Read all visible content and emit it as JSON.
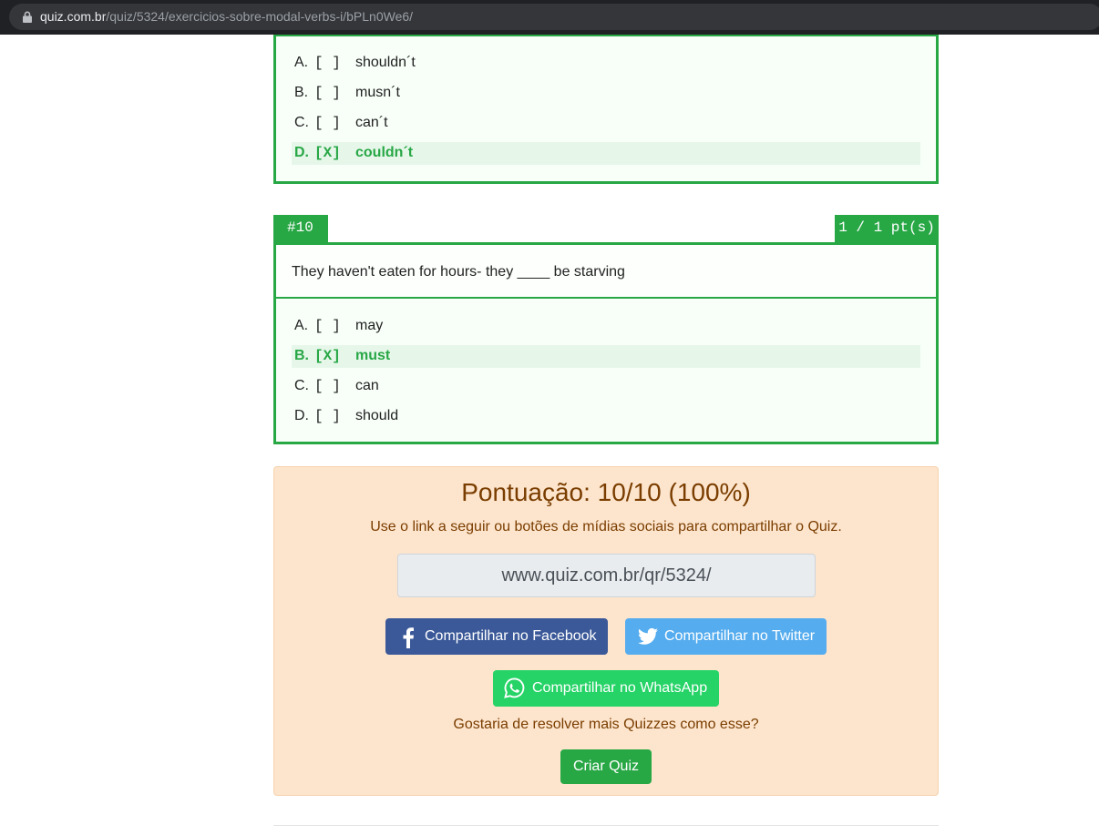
{
  "browser": {
    "url_host": "quiz.com.br",
    "url_path": "/quiz/5324/exercicios-sobre-modal-verbs-i/bPLn0We6/"
  },
  "question_prev": {
    "options": [
      {
        "letter": "A.",
        "mark": "[ ]",
        "text": "shouldn´t",
        "selected": false
      },
      {
        "letter": "B.",
        "mark": "[ ]",
        "text": "musn´t",
        "selected": false
      },
      {
        "letter": "C.",
        "mark": "[ ]",
        "text": "can´t",
        "selected": false
      },
      {
        "letter": "D.",
        "mark": "[X]",
        "text": "couldn´t",
        "selected": true
      }
    ]
  },
  "question_10": {
    "number": "#10",
    "points": "1 / 1 pt(s)",
    "stem": "They haven't eaten for hours- they ____ be starving",
    "options": [
      {
        "letter": "A.",
        "mark": "[ ]",
        "text": "may",
        "selected": false
      },
      {
        "letter": "B.",
        "mark": "[X]",
        "text": "must",
        "selected": true
      },
      {
        "letter": "C.",
        "mark": "[ ]",
        "text": "can",
        "selected": false
      },
      {
        "letter": "D.",
        "mark": "[ ]",
        "text": "should",
        "selected": false
      }
    ]
  },
  "score": {
    "title": "Pontuação: 10/10 (100%)",
    "subtitle": "Use o link a seguir ou botões de mídias sociais para compartilhar o Quiz.",
    "share_link": "www.quiz.com.br/qr/5324/",
    "facebook_label": "Compartilhar no Facebook",
    "twitter_label": "Compartilhar no Twitter",
    "whatsapp_label": "Compartilhar no WhatsApp",
    "more_prompt": "Gostaria de resolver mais Quizzes como esse?",
    "create_label": "Criar Quiz"
  },
  "colors": {
    "correct": "#28a745",
    "facebook": "#3b5998",
    "twitter": "#55acee",
    "whatsapp": "#25d366",
    "panel": "#fde5cd"
  }
}
